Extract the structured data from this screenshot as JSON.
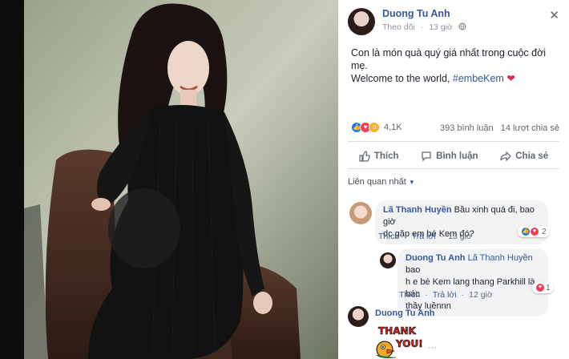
{
  "post": {
    "author": "Duong Tu Anh",
    "follow_label": "Theo dõi",
    "time": "13 giờ",
    "caption_line1": "Con là món quà quý giá nhất trong cuộc đời mẹ.",
    "caption_line2_prefix": "Welcome to the world, ",
    "caption_hashtag": "#embeKem",
    "caption_heart": "❤"
  },
  "stats": {
    "reactions_count": "4,1K",
    "comments": "393 bình luận",
    "shares": "14 lượt chia sẻ"
  },
  "actions": {
    "like": "Thích",
    "comment": "Bình luận",
    "share": "Chia sẻ"
  },
  "comments": {
    "sort_label": "Liên quan nhất",
    "c1": {
      "name": "Lã Thanh Huyền",
      "text1": " Bầu xinh quá đi, bao giờ",
      "text2": "dc gặp em bé Kem đó?",
      "like": "Thích",
      "reply": "Trả lời",
      "time": "13 giờ",
      "reactions": "2"
    },
    "c2": {
      "name": "Duong Tu Anh",
      "mention": "Lã Thanh Huyền",
      "text1": " bao",
      "text2": "h e bé Kem lang thang Parkhill là bác",
      "text3": "thầy luềnnn",
      "like": "Thích",
      "reply": "Trả lời",
      "time": "12 giờ",
      "reactions": "1"
    },
    "c3": {
      "name": "Duong Tu Anh",
      "sticker_text1": "THANK",
      "sticker_text2": "YOU!",
      "more": "···"
    }
  },
  "colors": {
    "link": "#365899",
    "like_blue": "#1877f2",
    "love_red": "#f33e58",
    "wow_yellow": "#f7b125"
  }
}
